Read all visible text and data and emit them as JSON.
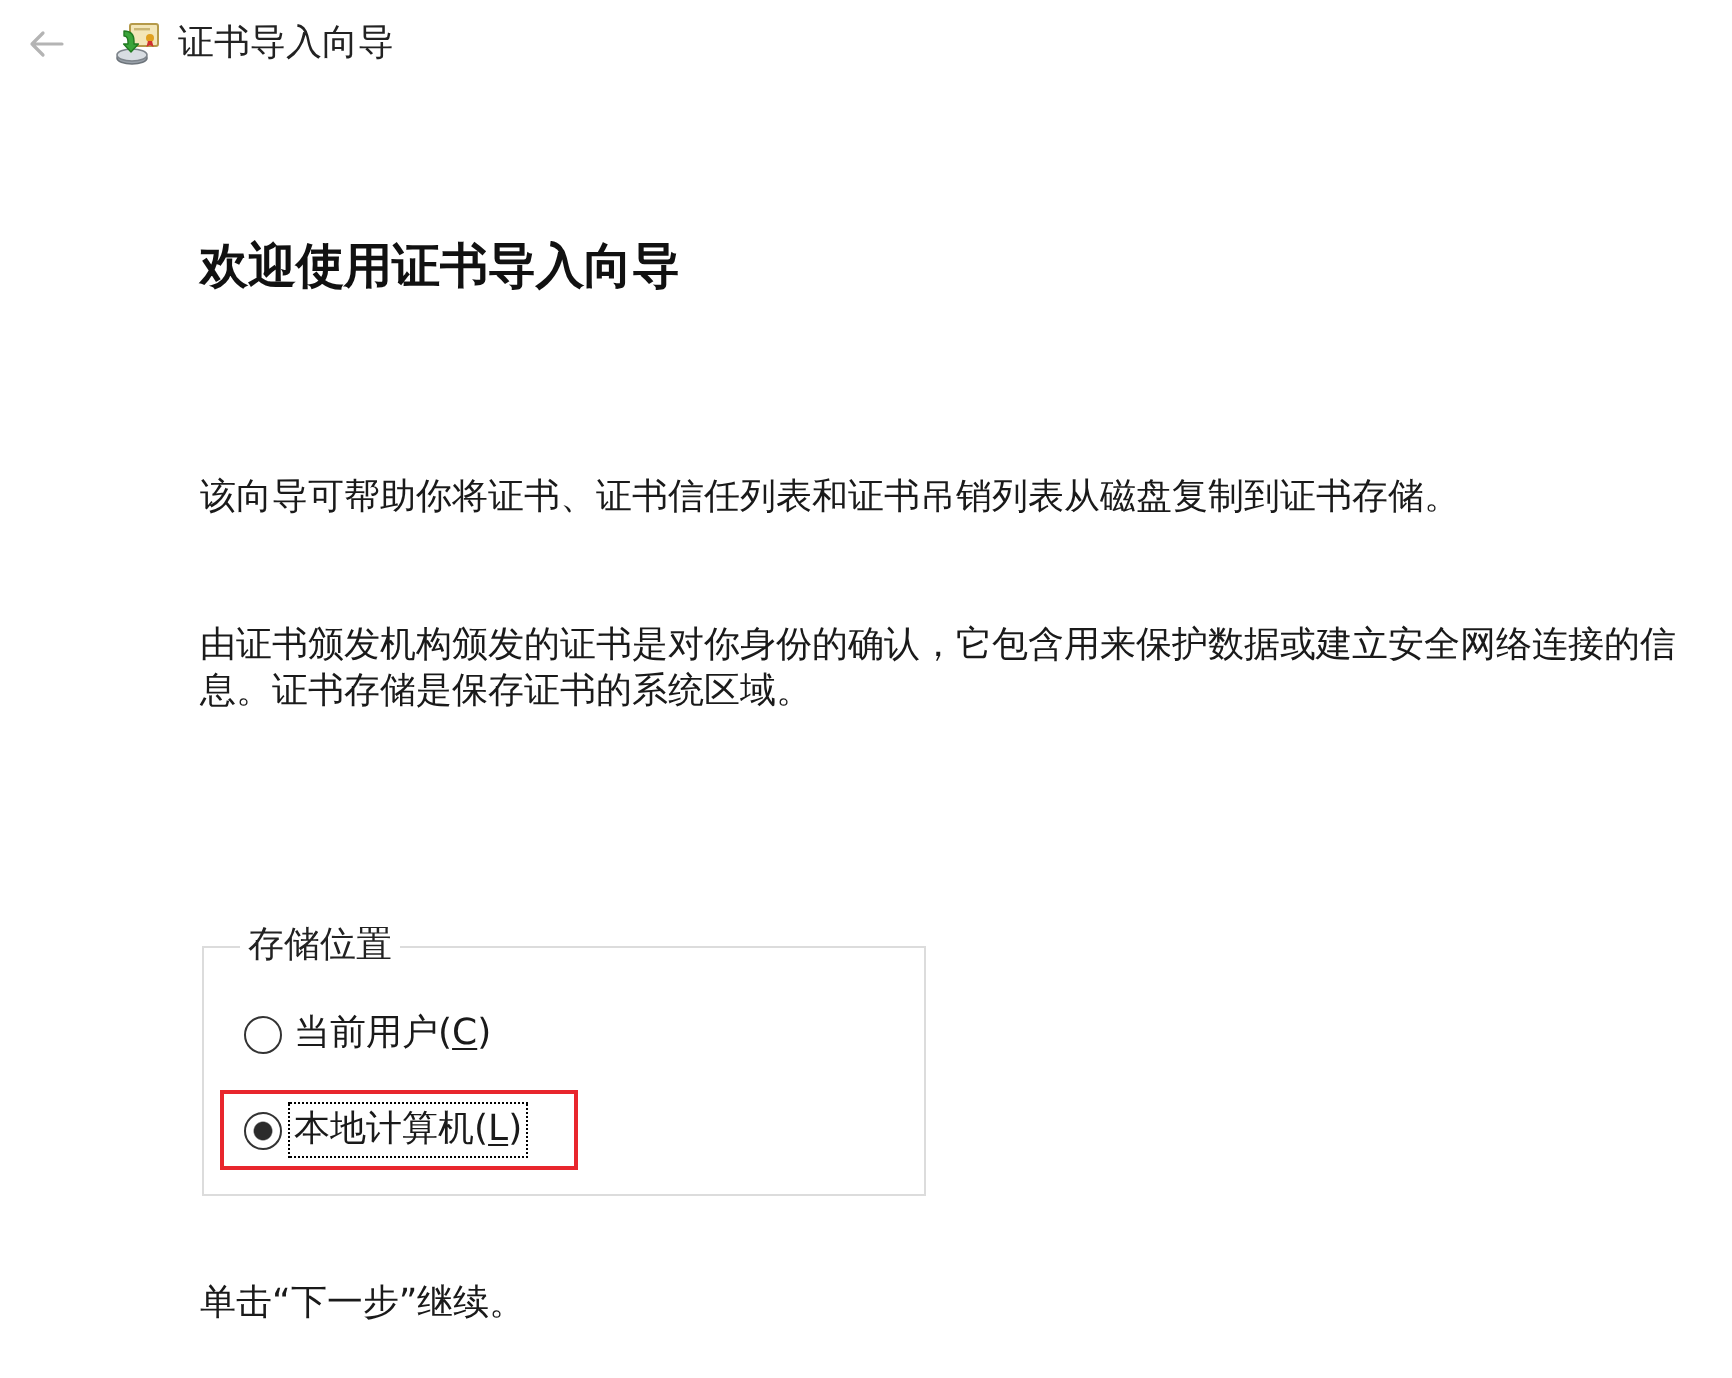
{
  "window": {
    "title": "证书导入向导",
    "back_button": {
      "disabled": true
    }
  },
  "heading": "欢迎使用证书导入向导",
  "paragraphs": [
    "该向导可帮助你将证书、证书信任列表和证书吊销列表从磁盘复制到证书存储。",
    "由证书颁发机构颁发的证书是对你身份的确认，它包含用来保护数据或建立安全网络连接的信息。证书存储是保存证书的系统区域。"
  ],
  "store_location": {
    "legend": "存储位置",
    "options": [
      {
        "text": "当前用户(",
        "access_key": "C",
        "text_end": ")",
        "selected": false,
        "focused": false,
        "highlighted": false
      },
      {
        "text": "本地计算机(",
        "access_key": "L",
        "text_end": ")",
        "selected": true,
        "focused": true,
        "highlighted": true
      }
    ]
  },
  "footer": "单击“下一步”继续。"
}
